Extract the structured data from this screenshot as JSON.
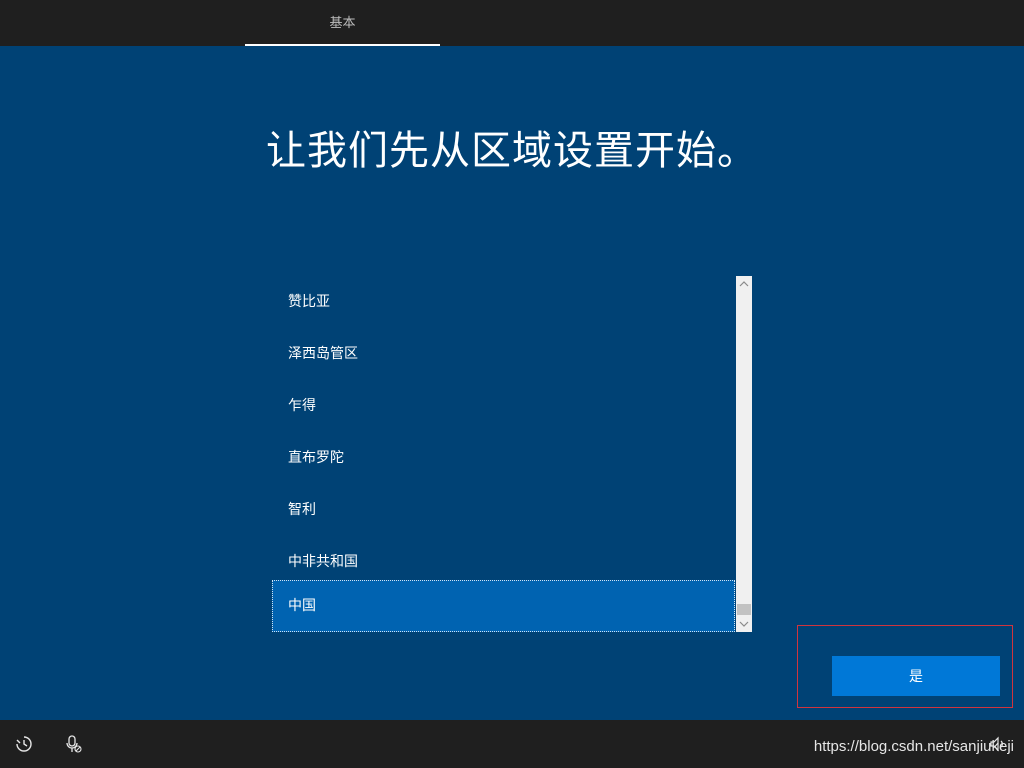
{
  "top_tab": {
    "label": "基本"
  },
  "title": "让我们先从区域设置开始。",
  "region_list": {
    "items": [
      "赞比亚",
      "泽西岛管区",
      "乍得",
      "直布罗陀",
      "智利",
      "中非共和国",
      "中国"
    ],
    "selected": "中国"
  },
  "yes_button": {
    "label": "是"
  },
  "icons": {
    "ease_of_access": "ease-of-access-icon",
    "microphone": "microphone-off-icon",
    "volume": "volume-icon",
    "scroll_up": "chevron-up-icon",
    "scroll_down": "chevron-down-icon"
  },
  "colors": {
    "background": "#004275",
    "bars": "#1f1f1f",
    "selected_item": "#0063b1",
    "button": "#0078d7",
    "highlight_border": "#d1343d"
  },
  "watermark": "https://blog.csdn.net/sanjiukeji"
}
